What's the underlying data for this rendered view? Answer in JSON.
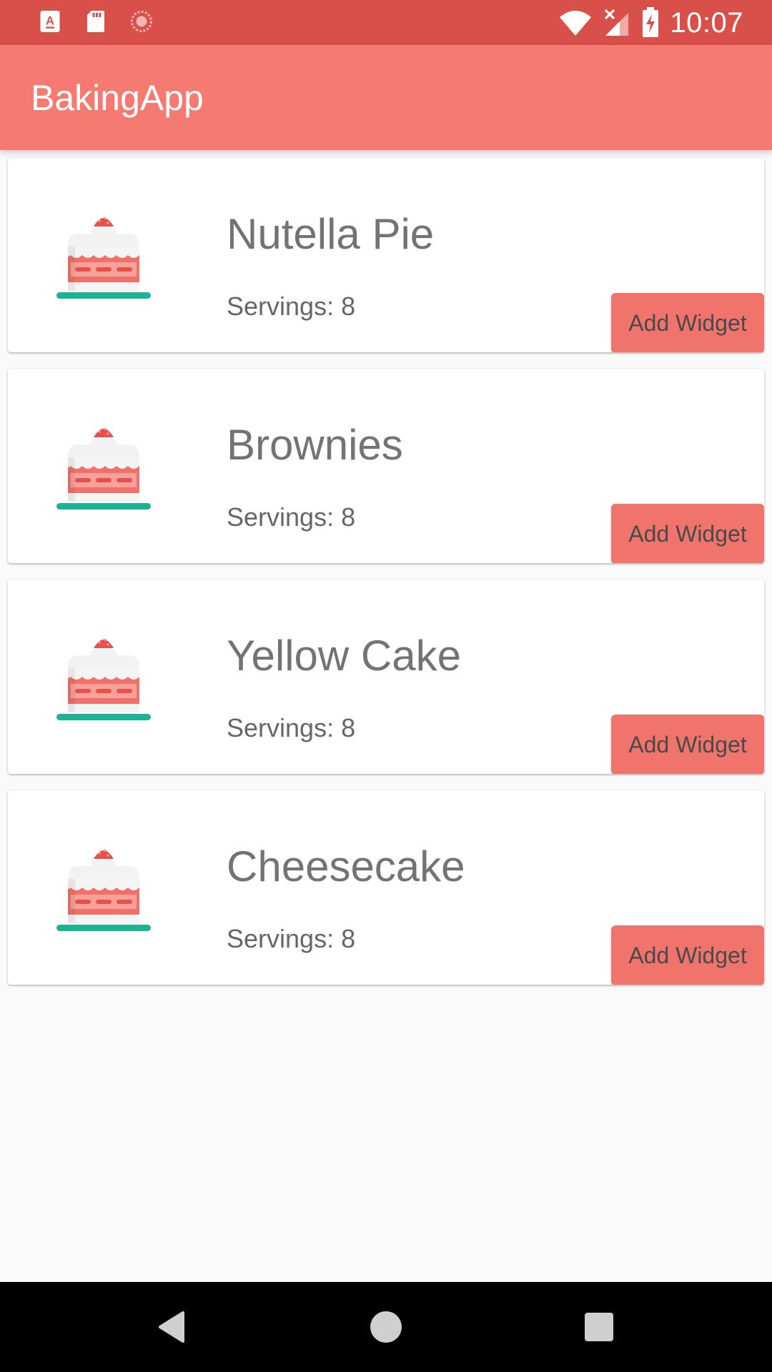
{
  "status_bar": {
    "time": "10:07",
    "icons_left": [
      "a-letter-notification-icon",
      "sd-card-icon",
      "sync-circle-icon"
    ],
    "icons_right": [
      "wifi-icon",
      "signal-icon",
      "battery-charging-icon"
    ]
  },
  "app_bar": {
    "title": "BakingApp",
    "color": "#f47a72"
  },
  "recipes": [
    {
      "name": "Nutella Pie",
      "servings": "Servings: 8",
      "button": "Add Widget",
      "icon": "cake-icon"
    },
    {
      "name": "Brownies",
      "servings": "Servings: 8",
      "button": "Add Widget",
      "icon": "cake-icon"
    },
    {
      "name": "Yellow Cake",
      "servings": "Servings: 8",
      "button": "Add Widget",
      "icon": "cake-icon"
    },
    {
      "name": "Cheesecake",
      "servings": "Servings: 8",
      "button": "Add Widget",
      "icon": "cake-icon"
    }
  ],
  "nav_bar": {
    "buttons": [
      "back-icon",
      "home-icon",
      "recents-icon"
    ]
  },
  "colors": {
    "status_bar": "#d94f49",
    "accent": "#f0736c",
    "plate": "#1ab394"
  }
}
